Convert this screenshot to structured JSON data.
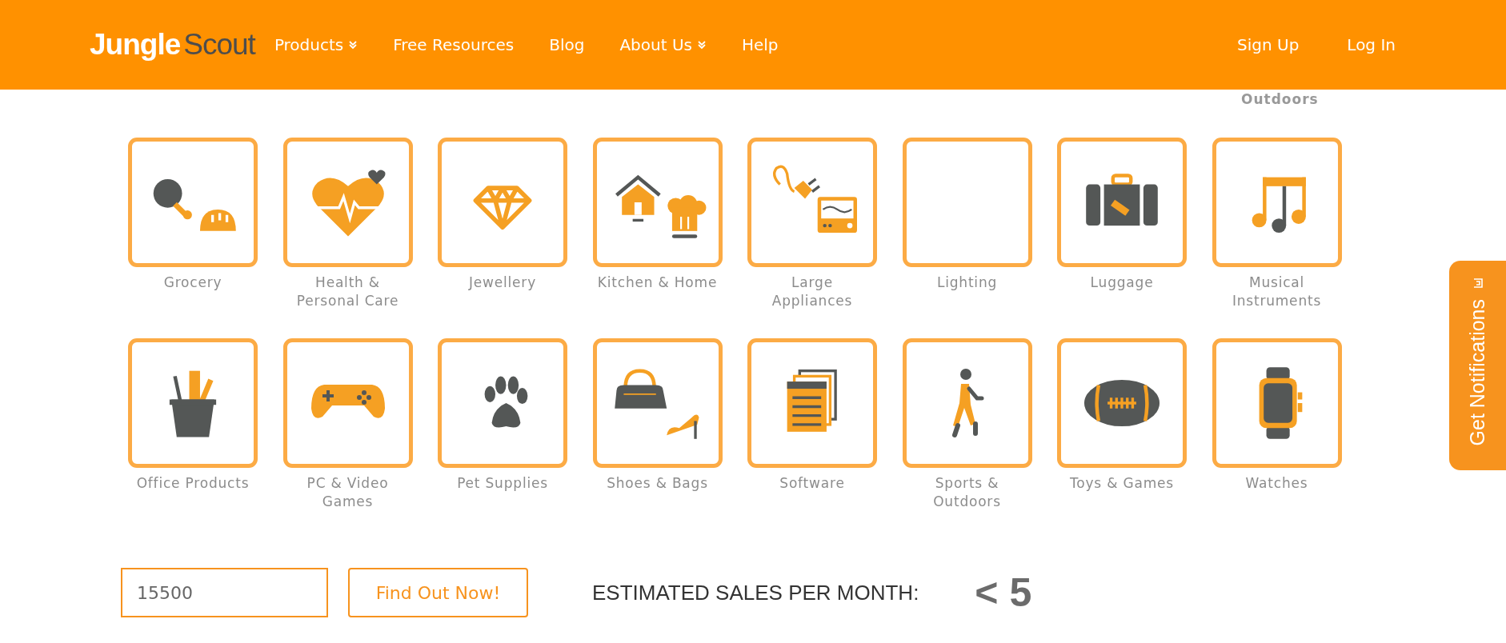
{
  "header": {
    "logo": {
      "part_1": "Jungle",
      "part_2": "Scout"
    },
    "nav": [
      {
        "label": "Products",
        "dropdown": true
      },
      {
        "label": "Free Resources",
        "dropdown": false
      },
      {
        "label": "Blog",
        "dropdown": false
      },
      {
        "label": "About Us",
        "dropdown": true
      },
      {
        "label": "Help",
        "dropdown": false
      }
    ],
    "account": [
      "Sign Up",
      "Log In"
    ]
  },
  "partial_label": "Outdoors",
  "categories": [
    {
      "label": "Grocery"
    },
    {
      "label": "Health &\nPersonal Care"
    },
    {
      "label": "Jewellery"
    },
    {
      "label": "Kitchen & Home"
    },
    {
      "label": "Large\nAppliances"
    },
    {
      "label": "Lighting"
    },
    {
      "label": "Luggage"
    },
    {
      "label": "Musical\nInstruments"
    },
    {
      "label": "Office Products"
    },
    {
      "label": "PC & Video\nGames"
    },
    {
      "label": "Pet Supplies"
    },
    {
      "label": "Shoes & Bags"
    },
    {
      "label": "Software"
    },
    {
      "label": "Sports &\nOutdoors"
    },
    {
      "label": "Toys & Games"
    },
    {
      "label": "Watches"
    }
  ],
  "estimator": {
    "value": "15500",
    "button": "Find Out Now!",
    "result_label": "ESTIMATED SALES PER MONTH:",
    "result": "< 5"
  },
  "notification_tab": {
    "label": "Get Notifications"
  }
}
